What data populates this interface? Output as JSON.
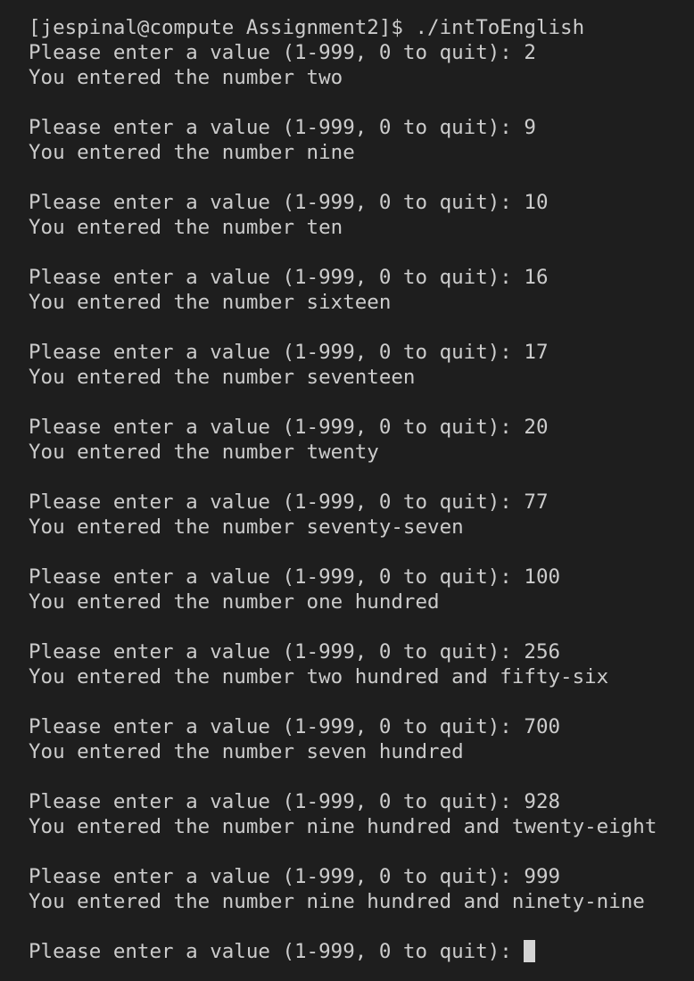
{
  "terminal": {
    "command_line": "[jespinal@compute Assignment2]$ ./intToEnglish",
    "exchanges": [
      {
        "prompt": "Please enter a value (1-999, 0 to quit): 2",
        "response": "You entered the number two"
      },
      {
        "prompt": "Please enter a value (1-999, 0 to quit): 9",
        "response": "You entered the number nine"
      },
      {
        "prompt": "Please enter a value (1-999, 0 to quit): 10",
        "response": "You entered the number ten"
      },
      {
        "prompt": "Please enter a value (1-999, 0 to quit): 16",
        "response": "You entered the number sixteen"
      },
      {
        "prompt": "Please enter a value (1-999, 0 to quit): 17",
        "response": "You entered the number seventeen"
      },
      {
        "prompt": "Please enter a value (1-999, 0 to quit): 20",
        "response": "You entered the number twenty"
      },
      {
        "prompt": "Please enter a value (1-999, 0 to quit): 77",
        "response": "You entered the number seventy-seven"
      },
      {
        "prompt": "Please enter a value (1-999, 0 to quit): 100",
        "response": "You entered the number one hundred"
      },
      {
        "prompt": "Please enter a value (1-999, 0 to quit): 256",
        "response": "You entered the number two hundred and fifty-six"
      },
      {
        "prompt": "Please enter a value (1-999, 0 to quit): 700",
        "response": "You entered the number seven hundred"
      },
      {
        "prompt": "Please enter a value (1-999, 0 to quit): 928",
        "response": "You entered the number nine hundred and twenty-eight"
      },
      {
        "prompt": "Please enter a value (1-999, 0 to quit): 999",
        "response": "You entered the number nine hundred and ninety-nine"
      }
    ],
    "final_prompt": "Please enter a value (1-999, 0 to quit): "
  },
  "colors": {
    "background": "#1e1e1e",
    "text": "#cccccc",
    "cursor": "#d4d4d4"
  }
}
